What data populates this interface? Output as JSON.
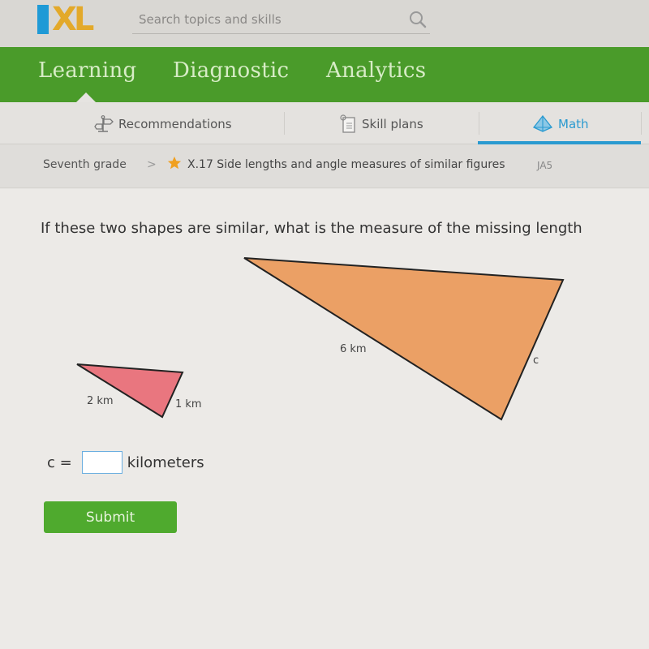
{
  "header": {
    "logo_text": "XL",
    "search": {
      "placeholder": "Search topics and skills",
      "value": ""
    }
  },
  "nav": {
    "items": [
      {
        "label": "Learning",
        "active": true
      },
      {
        "label": "Diagnostic",
        "active": false
      },
      {
        "label": "Analytics",
        "active": false
      }
    ]
  },
  "subtabs": {
    "items": [
      {
        "label": "Recommendations",
        "icon": "signpost-icon"
      },
      {
        "label": "Skill plans",
        "icon": "clipboard-icon"
      },
      {
        "label": "Math",
        "icon": "pyramid-icon",
        "active": true
      }
    ],
    "accent_color": "#2a9ad0"
  },
  "breadcrumb": {
    "grade": "Seventh grade",
    "separator": ">",
    "skill": "X.17 Side lengths and angle measures of similar figures",
    "code": "JA5"
  },
  "question": {
    "prompt": "If these two shapes are similar, what is the measure of the missing length",
    "small_triangle": {
      "labels": [
        "2 km",
        "1 km"
      ],
      "fill": "#e9767f"
    },
    "large_triangle": {
      "labels": [
        "6 km",
        "c"
      ],
      "fill": "#eba065"
    }
  },
  "answer": {
    "variable": "c =",
    "value": "",
    "unit": "kilometers"
  },
  "submit_label": "Submit"
}
